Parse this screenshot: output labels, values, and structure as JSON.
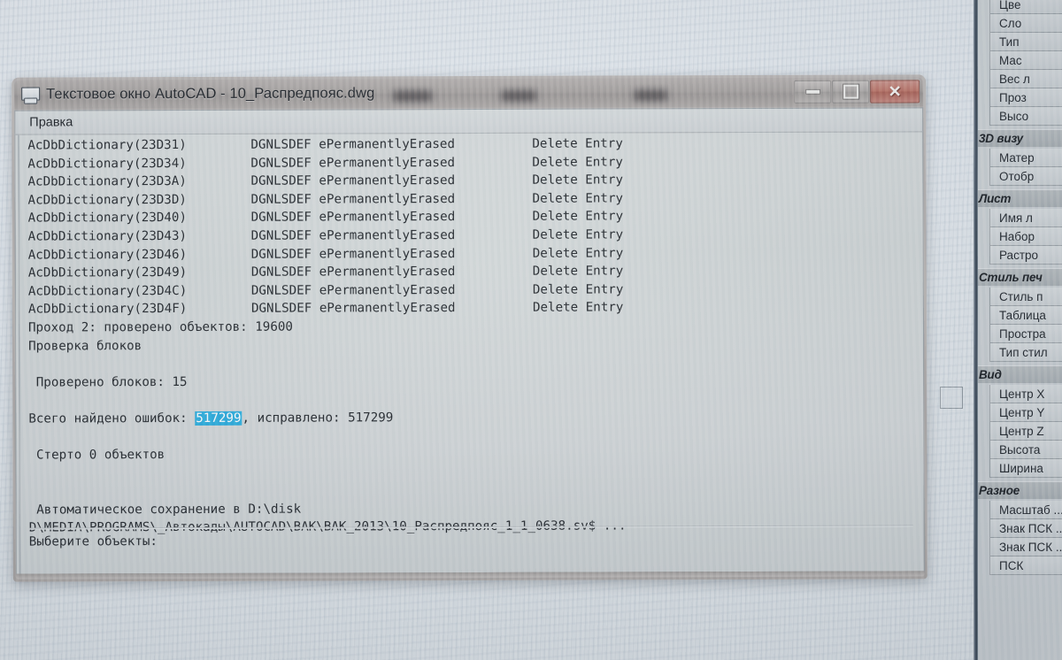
{
  "window": {
    "title": "Текстовое окно AutoCAD - 10_Распредпояс.dwg",
    "icon": "text-window-icon",
    "menu": {
      "edit": "Правка"
    },
    "controls": {
      "minimize": "minimize-icon",
      "maximize": "maximize-icon",
      "close": "✕"
    }
  },
  "console": {
    "dictionary_header": {
      "col1": "AcDbDictionary",
      "col2": "DGNLSDEF",
      "status": "ePermanentlyErased",
      "action": "Delete Entry"
    },
    "dictionary_rows": [
      {
        "object": "AcDbDictionary(23D31)",
        "type": "DGNLSDEF ePermanentlyErased",
        "action": "Delete Entry"
      },
      {
        "object": "AcDbDictionary(23D34)",
        "type": "DGNLSDEF ePermanentlyErased",
        "action": "Delete Entry"
      },
      {
        "object": "AcDbDictionary(23D3A)",
        "type": "DGNLSDEF ePermanentlyErased",
        "action": "Delete Entry"
      },
      {
        "object": "AcDbDictionary(23D3D)",
        "type": "DGNLSDEF ePermanentlyErased",
        "action": "Delete Entry"
      },
      {
        "object": "AcDbDictionary(23D40)",
        "type": "DGNLSDEF ePermanentlyErased",
        "action": "Delete Entry"
      },
      {
        "object": "AcDbDictionary(23D43)",
        "type": "DGNLSDEF ePermanentlyErased",
        "action": "Delete Entry"
      },
      {
        "object": "AcDbDictionary(23D46)",
        "type": "DGNLSDEF ePermanentlyErased",
        "action": "Delete Entry"
      },
      {
        "object": "AcDbDictionary(23D49)",
        "type": "DGNLSDEF ePermanentlyErased",
        "action": "Delete Entry"
      },
      {
        "object": "AcDbDictionary(23D4C)",
        "type": "DGNLSDEF ePermanentlyErased",
        "action": "Delete Entry"
      },
      {
        "object": "AcDbDictionary(23D4F)",
        "type": "DGNLSDEF ePermanentlyErased",
        "action": "Delete Entry"
      }
    ],
    "pass_line": "Проход 2: проверено объектов: 19600",
    "blocks_check": "Проверка блоков",
    "blocks_checked": " Проверено блоков: 15",
    "errors_prefix": "Всего найдено ошибок: ",
    "errors_found": "517299",
    "errors_suffix": ", исправлено: 517299",
    "erased": " Стерто 0 объектов",
    "autosave_line1": " Автоматическое сохранение в D:\\disk",
    "autosave_line2": "D\\MEDIA\\PROGRAMS\\_Автокады\\AUTOCAD\\BAK\\BAK_2013\\10_Распредпояс_1_1_0638.sv$ ...",
    "prompt": "Выберите объекты:",
    "selection_color": "#2aa9dd"
  },
  "properties_palette": {
    "groups": [
      {
        "header": null,
        "rows": [
          "Цве",
          "Сло",
          "Тип",
          "Мас",
          "Вес л",
          "Проз",
          "Высо"
        ]
      },
      {
        "header": "3D визу",
        "rows": [
          "Матер",
          "Отобр"
        ]
      },
      {
        "header": "Лист",
        "rows": [
          "Имя л",
          "Набор",
          "Растро"
        ]
      },
      {
        "header": "Стиль печ",
        "rows": [
          "Стиль п",
          "Таблица",
          "Простра",
          "Тип стил"
        ]
      },
      {
        "header": "Вид",
        "rows": [
          "Центр X",
          "Центр Y",
          "Центр Z",
          "Высота",
          "Ширина"
        ]
      },
      {
        "header": "Разное",
        "rows": [
          "Масштаб ...",
          "Знак ПСК ...",
          "Знак ПСК ...",
          "ПСК"
        ]
      }
    ]
  }
}
